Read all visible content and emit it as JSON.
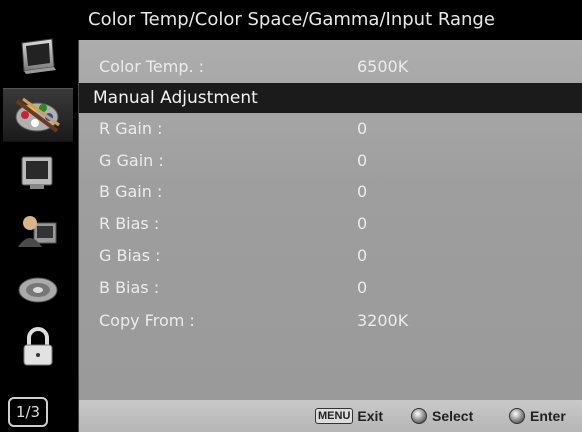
{
  "title": "Color Temp/Color Space/Gamma/Input Range",
  "sidebar": {
    "items": [
      {
        "icon": "monitor-icon",
        "active": false
      },
      {
        "icon": "palette-icon",
        "active": true
      },
      {
        "icon": "picture-icon",
        "active": false
      },
      {
        "icon": "user-settings-icon",
        "active": false
      },
      {
        "icon": "audio-disc-icon",
        "active": false
      },
      {
        "icon": "lock-icon",
        "active": false
      }
    ],
    "page_indicator": "1/3"
  },
  "menu": {
    "color_temp": {
      "label": "Color Temp. :",
      "value": "6500K"
    },
    "section_manual": "Manual Adjustment",
    "rows": [
      {
        "label": "R Gain :",
        "value": "0"
      },
      {
        "label": "G Gain :",
        "value": "0"
      },
      {
        "label": "B Gain :",
        "value": "0"
      },
      {
        "label": "R Bias :",
        "value": "0"
      },
      {
        "label": "G Bias :",
        "value": "0"
      },
      {
        "label": "B Bias :",
        "value": "0"
      }
    ],
    "copy_from": {
      "label": "Copy From :",
      "value": "3200K"
    }
  },
  "footer": {
    "menu_key": "MENU",
    "exit_label": "Exit",
    "select_label": "Select",
    "enter_label": "Enter"
  },
  "colors": {
    "panel_bg": "#a3a3a3",
    "section_bg": "#1b1b1b",
    "text": "#ececec",
    "footer_bg": "#c0c0c0"
  }
}
